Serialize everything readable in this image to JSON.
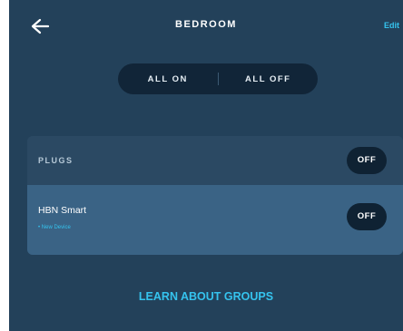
{
  "header": {
    "title": "BEDROOM",
    "edit_label": "Edit",
    "back_icon": "back-arrow-icon"
  },
  "controls": {
    "all_on_label": "ALL ON",
    "all_off_label": "ALL OFF"
  },
  "group": {
    "name": "PLUGS",
    "state_label": "OFF",
    "devices": [
      {
        "name": "HBN Smart",
        "subtitle": "• New Device",
        "state_label": "OFF"
      }
    ]
  },
  "footer": {
    "learn_label": "LEARN ABOUT GROUPS"
  },
  "colors": {
    "background": "#23415a",
    "accent": "#35c3ee",
    "pill": "#0f2233",
    "device_row": "#3a6385"
  }
}
